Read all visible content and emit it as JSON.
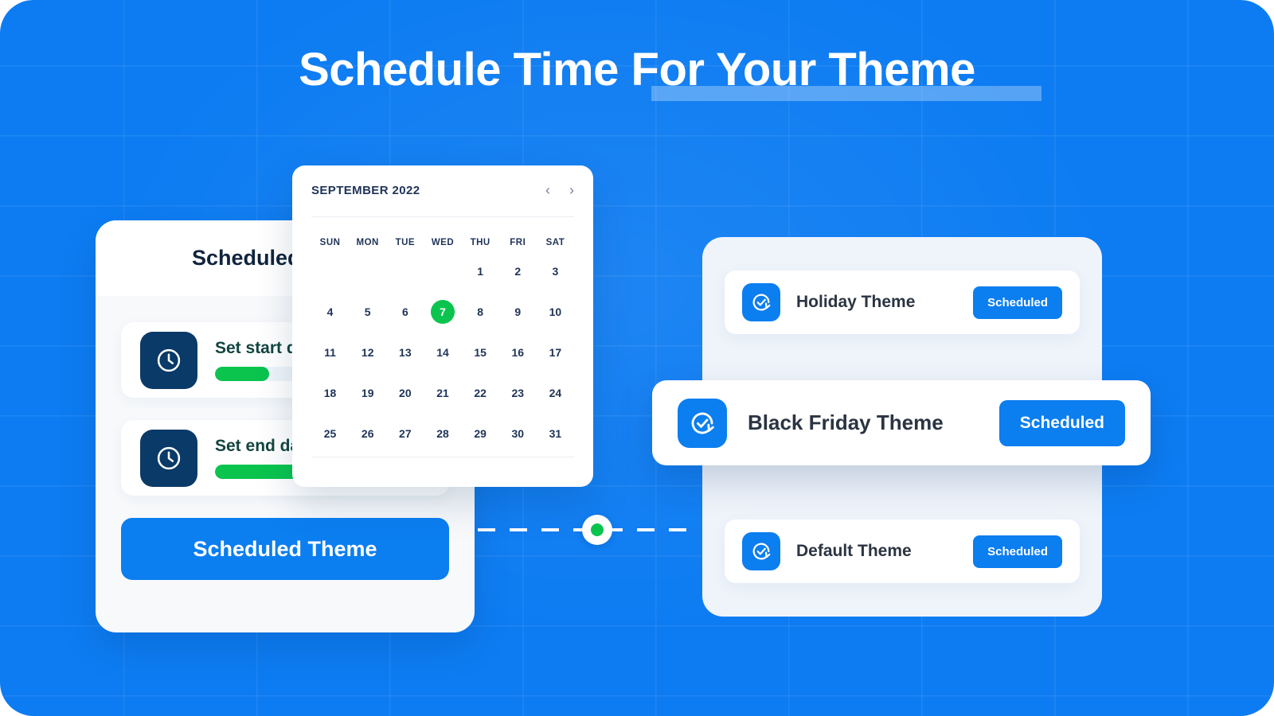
{
  "page": {
    "title_lead": "Schedule Time ",
    "title_highlight": "For Your Theme"
  },
  "left_panel": {
    "title": "Scheduled banner",
    "rows": [
      {
        "label": "Set start date",
        "icon": "clock-icon",
        "progress": 25
      },
      {
        "label": "Set end date",
        "icon": "clock-icon",
        "progress": 86
      }
    ],
    "cta_label": "Scheduled Theme"
  },
  "calendar": {
    "month_label": "SEPTEMBER 2022",
    "prev_icon": "chevron-left-icon",
    "next_icon": "chevron-right-icon",
    "day_headers": [
      "SUN",
      "MON",
      "TUE",
      "WED",
      "THU",
      "FRI",
      "SAT"
    ],
    "days": [
      1,
      2,
      3,
      4,
      5,
      6,
      7,
      8,
      9,
      10,
      11,
      12,
      13,
      14,
      15,
      16,
      17,
      18,
      19,
      20,
      21,
      22,
      23,
      24,
      25,
      26,
      27,
      28,
      29,
      30,
      31
    ],
    "selected_day": 7,
    "selected_color": "#0ac44e"
  },
  "connector": {
    "node_icon": "connector-node-dot"
  },
  "themes": [
    {
      "name": "Holiday Theme",
      "status": "Scheduled",
      "icon": "check-refresh-icon"
    },
    {
      "name": "Black Friday Theme",
      "status": "Scheduled",
      "icon": "check-refresh-icon"
    },
    {
      "name": "Default Theme",
      "status": "Scheduled",
      "icon": "check-refresh-icon"
    }
  ],
  "colors": {
    "background_blue": "#0d7cf2",
    "accent_blue": "#0b7ef0",
    "accent_green": "#0ac44e",
    "navy": "#0a3a68"
  }
}
